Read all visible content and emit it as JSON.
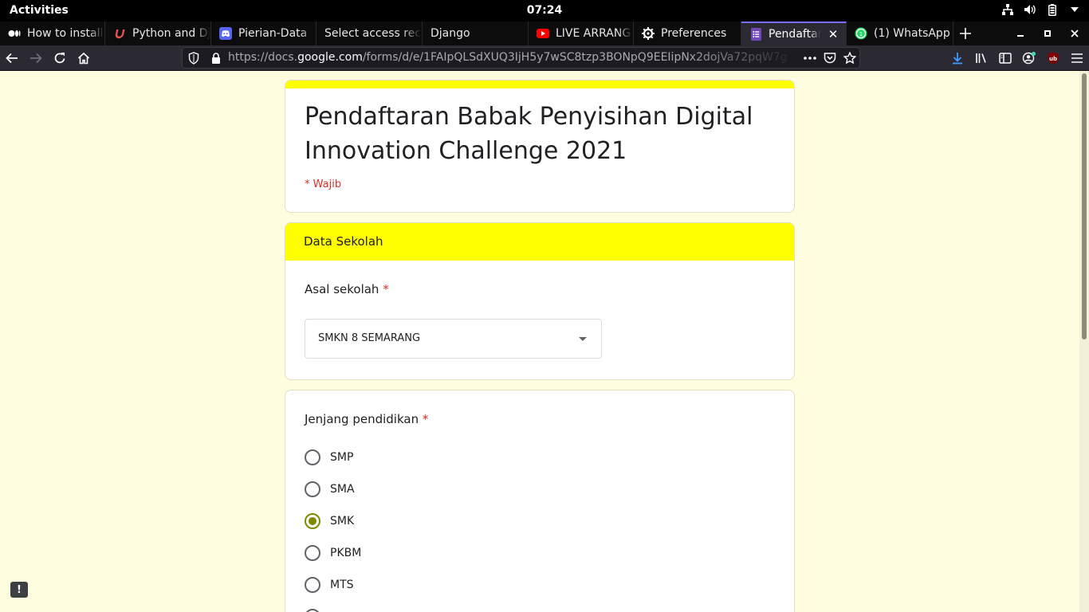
{
  "system": {
    "activities": "Activities",
    "clock": "07:24"
  },
  "tabs": [
    {
      "label": "How to install",
      "icon": "medium-icon"
    },
    {
      "label": "Python and Dj",
      "icon": "udemy-icon"
    },
    {
      "label": "Pierian-Data",
      "icon": "discord-icon"
    },
    {
      "label": "Select access rec",
      "icon": ""
    },
    {
      "label": "Django",
      "icon": ""
    },
    {
      "label": "LIVE ARRANG",
      "icon": "youtube-icon"
    },
    {
      "label": "Preferences",
      "icon": "gear-icon"
    },
    {
      "label": "Pendaftara",
      "icon": "google-forms-icon",
      "active": true
    },
    {
      "label": "(1) WhatsApp",
      "icon": "whatsapp-icon"
    }
  ],
  "url": {
    "prefix": "https://docs.",
    "domain": "google.com",
    "rest": "/forms/d/e/1FAIpQLSdXUQ3IjH5y7wSC8tzp3BONpQ9EEIipNx2dojVa72pqW7g"
  },
  "form": {
    "title": "Pendaftaran Babak Penyisihan Digital Innovation Challenge 2021",
    "required_note": "* Wajib",
    "section_title": "Data Sekolah",
    "q1": {
      "label": "Asal sekolah",
      "required_mark": "*",
      "value": "SMKN 8 SEMARANG"
    },
    "q2": {
      "label": "Jenjang pendidikan",
      "required_mark": "*",
      "options": [
        {
          "label": "SMP",
          "checked": false
        },
        {
          "label": "SMA",
          "checked": false
        },
        {
          "label": "SMK",
          "checked": true
        },
        {
          "label": "PKBM",
          "checked": false
        },
        {
          "label": "MTS",
          "checked": false
        }
      ]
    }
  },
  "feedback": {
    "label": "!"
  },
  "colors": {
    "accent": "#ffff00",
    "page_bg": "#fffde0",
    "radio_checked": "#7d8a00",
    "required": "#d93025"
  }
}
